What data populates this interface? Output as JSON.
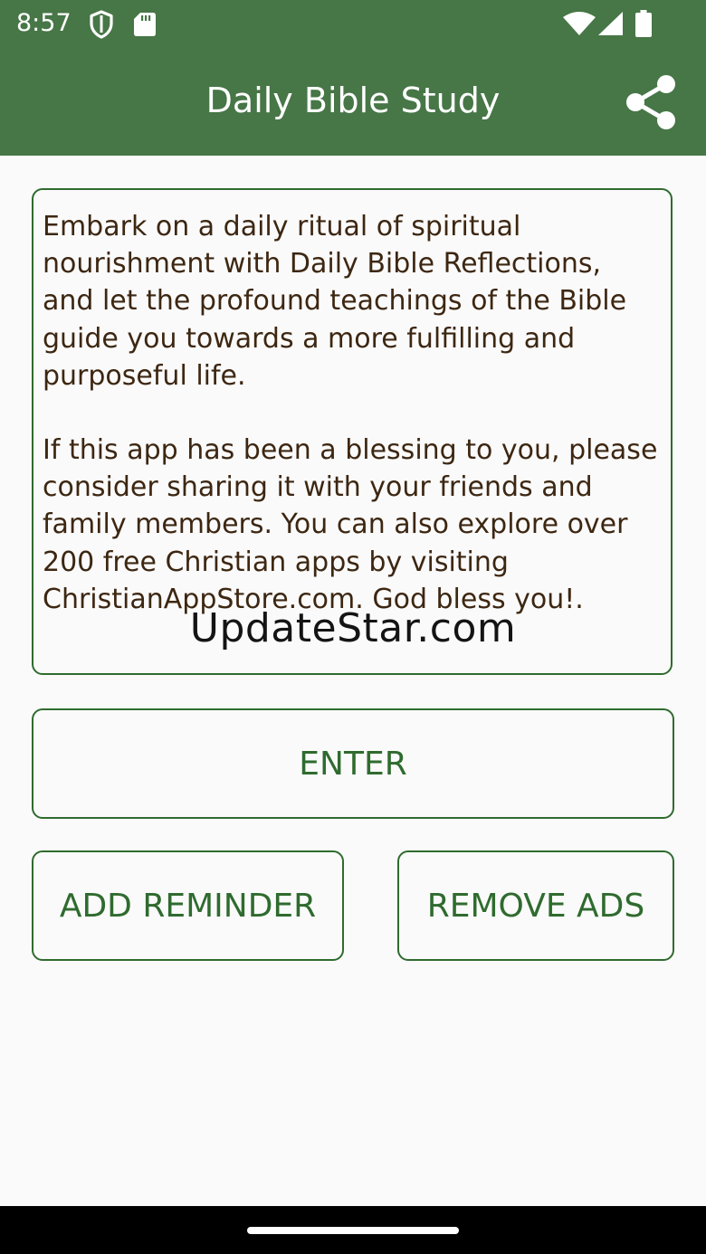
{
  "status_bar": {
    "time": "8:57",
    "icons": [
      "shield-icon",
      "sd-card-icon",
      "wifi-icon",
      "cell-signal-icon",
      "battery-icon"
    ]
  },
  "app_bar": {
    "title": "Daily Bible Study",
    "share_icon": "share-icon",
    "background_color": "#477647"
  },
  "description": {
    "paragraph_1": "Embark on a daily ritual of spiritual nourishment with Daily Bible Reflections, and let the profound teachings of the Bible guide you towards a more fulfilling and purposeful life.",
    "paragraph_2": "If this app has been a blessing to you, please consider sharing it with your friends and family members. You can also explore over 200 free Christian apps by visiting ChristianAppStore.com. God bless you!.",
    "text_color": "#3d2712"
  },
  "watermark": "UpdateStar.com",
  "buttons": {
    "enter": "ENTER",
    "add_reminder": "ADD REMINDER",
    "remove_ads": "REMOVE ADS",
    "accent_color": "#2f6b2f"
  }
}
